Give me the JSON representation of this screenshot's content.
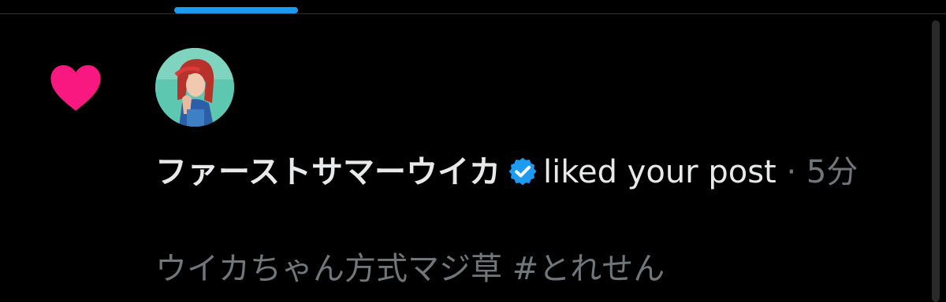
{
  "colors": {
    "background": "#000000",
    "accent": "#1d9bf0",
    "like": "#f91880",
    "text_primary": "#e7e9ea",
    "text_secondary": "#71767b"
  },
  "notification": {
    "type_icon": "heart-icon",
    "user_name": "ファーストサマーウイカ",
    "verified": true,
    "action": "liked your post",
    "separator": " · ",
    "time": "5分",
    "post_snippet": "ウイカちゃん方式マジ草 #とれせん"
  }
}
